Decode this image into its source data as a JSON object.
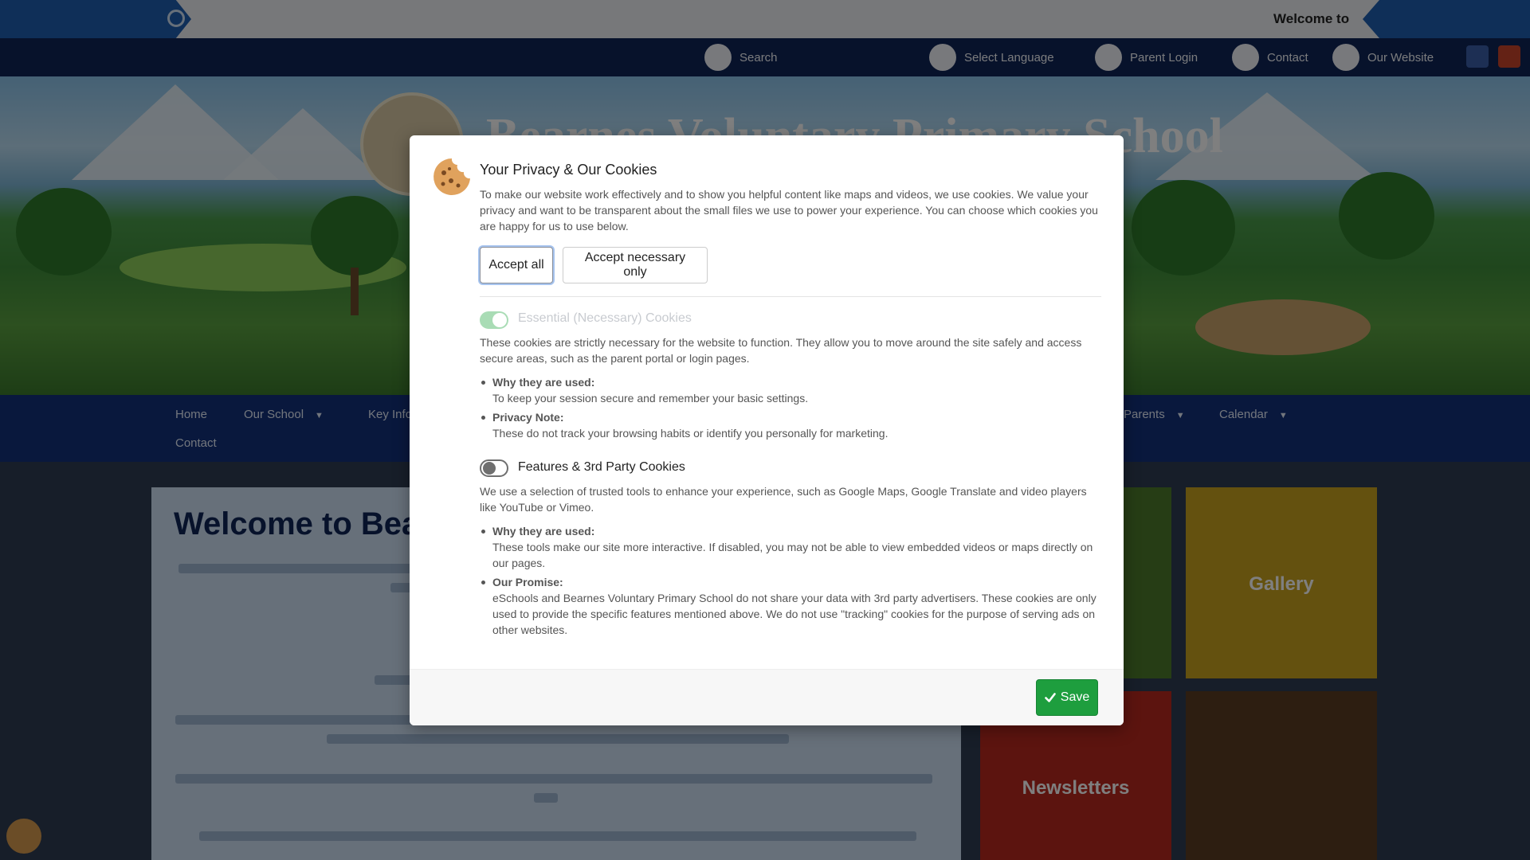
{
  "welcome_bar": {
    "text": "Welcome to"
  },
  "topbar": {
    "items": [
      {
        "label": "Search",
        "icon": "search-icon"
      },
      {
        "label": "Select Language",
        "icon": "translate-icon"
      },
      {
        "label": "Parent Login",
        "icon": "login-icon"
      },
      {
        "label": "Contact",
        "icon": "phone-icon"
      },
      {
        "label": "Our Website",
        "icon": "globe-icon"
      }
    ],
    "social": [
      "facebook-icon",
      "school-badge-icon"
    ]
  },
  "hero": {
    "school_name": "Bearnes Voluntary Primary School"
  },
  "nav": {
    "items": [
      {
        "label": "Home"
      },
      {
        "label": "Our School",
        "caret": "▼"
      },
      {
        "label": "Key Info",
        "caret": "▼"
      },
      {
        "label": "Parents",
        "caret": "▼"
      },
      {
        "label": "Calendar",
        "caret": "▼"
      },
      {
        "label": "Contact"
      }
    ]
  },
  "content": {
    "title": "Welcome to Bearnes"
  },
  "tiles": [
    {
      "label": "",
      "color": "#4c7a2a"
    },
    {
      "label": "Gallery",
      "color": "#c9a21f"
    },
    {
      "label": "Newsletters",
      "color": "#b8281f"
    },
    {
      "label": "",
      "color": "#5a3d22"
    }
  ],
  "modal": {
    "title": "Your Privacy & Our Cookies",
    "intro": "To make our website work effectively and to show you helpful content like maps and videos, we use cookies. We value your privacy and want to be transparent about the small files we use to power your experience. You can choose which cookies you are happy for us to use below.",
    "accept_all": "Accept all",
    "accept_necessary": "Accept necessary only",
    "essential": {
      "title": "Essential (Necessary) Cookies",
      "enabled": true,
      "description": "These cookies are strictly necessary for the website to function. They allow you to move around the site safely and access secure areas, such as the parent portal or login pages.",
      "bullets": [
        {
          "head": "Why they are used:",
          "text": "To keep your session secure and remember your basic settings."
        },
        {
          "head": "Privacy Note:",
          "text": "These do not track your browsing habits or identify you personally for marketing."
        }
      ]
    },
    "features": {
      "title": "Features & 3rd Party Cookies",
      "enabled": false,
      "description": "We use a selection of trusted tools to enhance your experience, such as Google Maps, Google Translate and video players like YouTube or Vimeo.",
      "bullets": [
        {
          "head": "Why they are used:",
          "text": "These tools make our site more interactive. If disabled, you may not be able to view embedded videos or maps directly on our pages."
        },
        {
          "head": "Our Promise:",
          "text": "eSchools and Bearnes Voluntary Primary School do not share your data with 3rd party advertisers. These cookies are only used to provide the specific features mentioned above. We do not use \"tracking\" cookies for the purpose of serving ads on other websites."
        }
      ]
    },
    "save": "Save"
  },
  "colors": {
    "save_green": "#1e9e3e",
    "toggle_on": "#a9dcb5",
    "navy": "#12307a"
  }
}
